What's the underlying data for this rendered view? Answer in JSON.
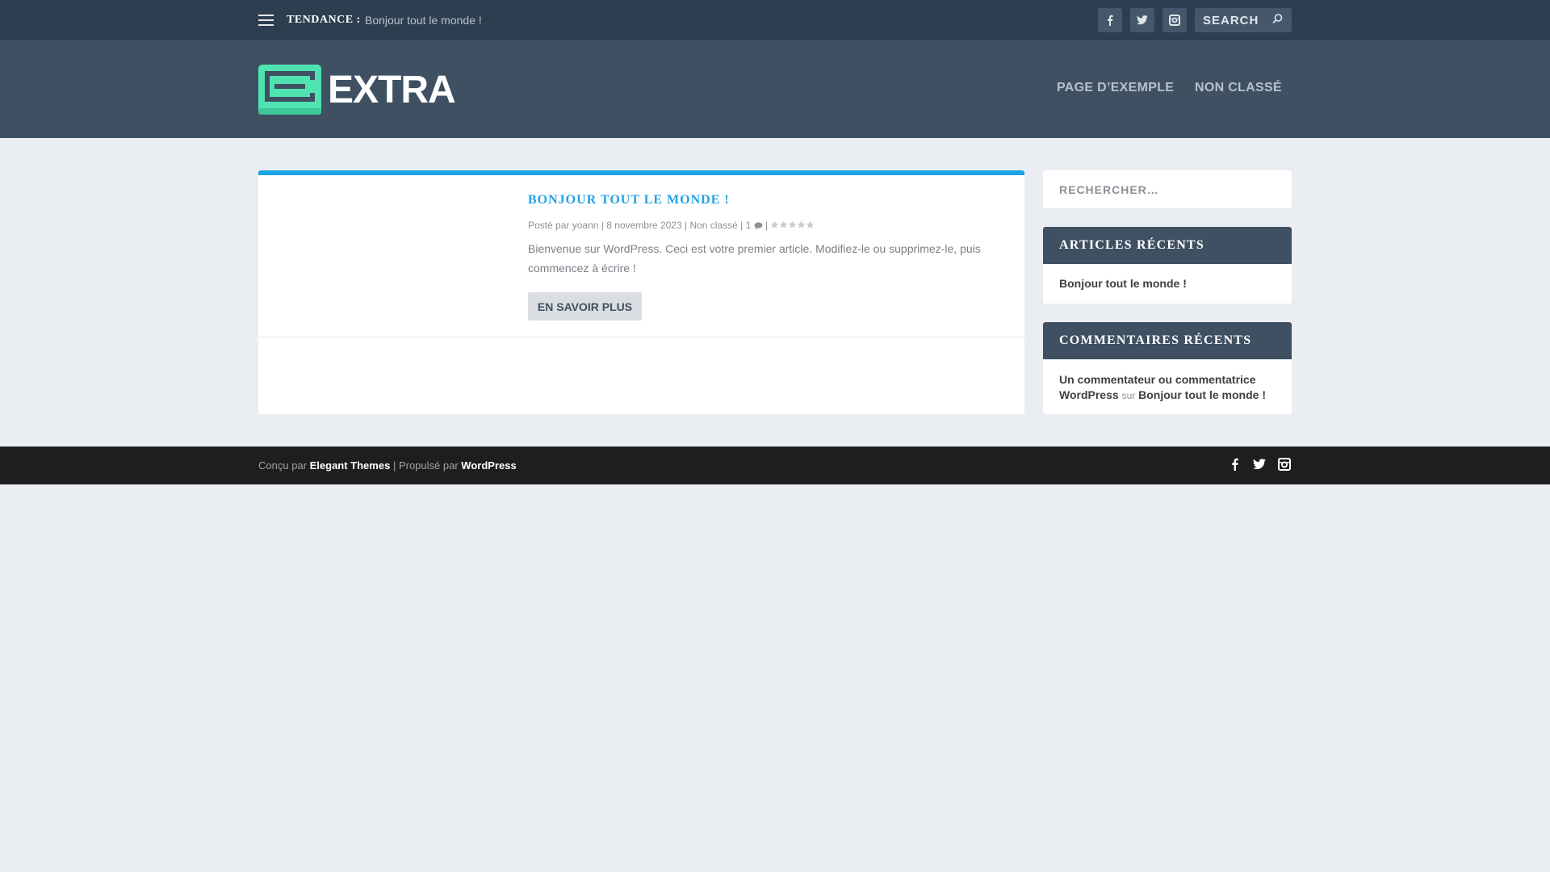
{
  "topbar": {
    "trending_label": "TENDANCE :",
    "trending_link": "Bonjour tout le monde !",
    "search_placeholder": "SEARCH",
    "social": [
      "facebook-icon",
      "twitter-icon",
      "instagram-icon"
    ]
  },
  "header": {
    "logo_text": "EXTRA",
    "logo_color": "#4fe3b1",
    "nav": [
      "PAGE D’EXEMPLE",
      "NON CLASSÉ"
    ]
  },
  "post": {
    "title": "BONJOUR TOUT LE MONDE !",
    "meta_prefix": "Posté par",
    "author": "yoann",
    "date": "8 novembre 2023",
    "category": "Non classé",
    "comments": "1",
    "excerpt": "Bienvenue sur WordPress. Ceci est votre premier article. Modifiez-le ou supprimez-le, puis commencez à écrire !",
    "more_label": "EN SAVOIR PLUS",
    "accent_color": "#1fa2e6",
    "rating": 0
  },
  "sidebar": {
    "search_placeholder": "RECHERCHER…",
    "recent_posts": {
      "title": "ARTICLES RÉCENTS",
      "items": [
        "Bonjour tout le monde !"
      ]
    },
    "recent_comments": {
      "title": "COMMENTAIRES RÉCENTS",
      "author": "Un commentateur ou commentatrice WordPress",
      "connector": "sur",
      "post": "Bonjour tout le monde !"
    }
  },
  "footer": {
    "designed_by": "Conçu par",
    "designer": "Elegant Themes",
    "separator": "|",
    "powered_by": "Propulsé par",
    "platform": "WordPress",
    "social": [
      "facebook-icon",
      "twitter-icon",
      "instagram-icon"
    ]
  }
}
